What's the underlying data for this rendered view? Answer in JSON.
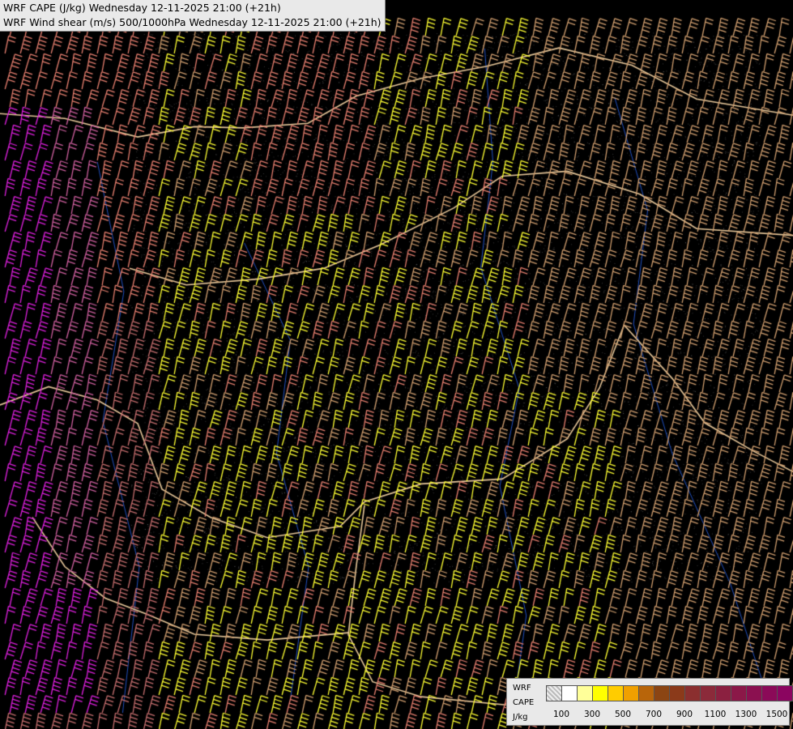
{
  "title": {
    "line1": "WRF CAPE (J/kg) Wednesday 12-11-2025 21:00 (+21h)",
    "line2": "WRF Wind shear (m/s) 500/1000hPa Wednesday 12-11-2025 21:00 (+21h)"
  },
  "legend": {
    "model_label": "WRF",
    "field_label": "CAPE",
    "unit_label": "J/kg",
    "swatch_colors": [
      "hatched",
      "#ffffff",
      "#ffff99",
      "#ffff00",
      "#ffcc00",
      "#f0a000",
      "#b8650a",
      "#8b4513",
      "#8b3a1a",
      "#8b2f2f",
      "#8b2a3a",
      "#8b2040",
      "#8b1848",
      "#8b1050",
      "#8b0a58",
      "#8b0560"
    ],
    "tick_labels": [
      "100",
      "300",
      "500",
      "700",
      "900",
      "1100",
      "1300",
      "1500"
    ]
  },
  "map_colors": {
    "background": "#000000",
    "border": "#e8c89a",
    "river": "#2050c0",
    "barb_yellow": "#ffff33",
    "barb_tan": "#d2a070",
    "barb_salmon": "#e88070",
    "barb_rose": "#c87070",
    "barb_magenta": "#e020e0",
    "barb_pink": "#d060a0"
  }
}
